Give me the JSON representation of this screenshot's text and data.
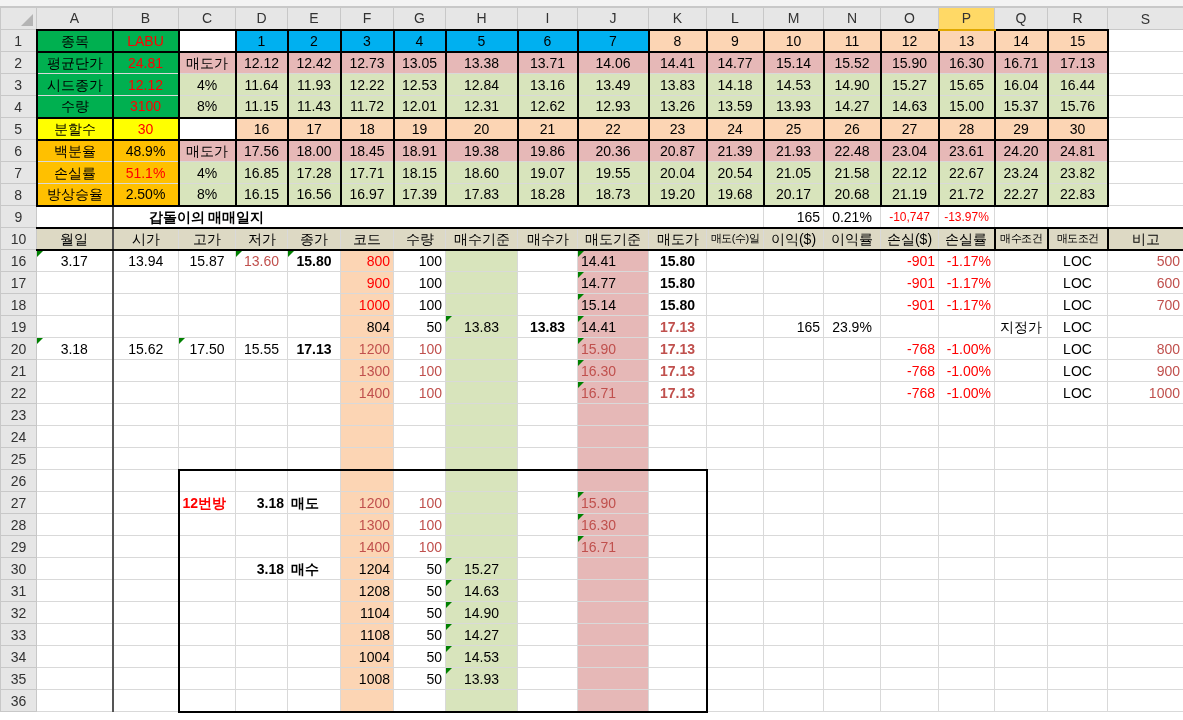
{
  "columns": [
    {
      "label": "A",
      "selected": false,
      "kind": "plain"
    },
    {
      "label": "B",
      "selected": false,
      "kind": "plain"
    },
    {
      "label": "C",
      "selected": false,
      "kind": "plain"
    },
    {
      "label": "D",
      "selected": false,
      "kind": "plain"
    },
    {
      "label": "E",
      "selected": false,
      "kind": "plain"
    },
    {
      "label": "F",
      "selected": false,
      "kind": "peach"
    },
    {
      "label": "G",
      "selected": false,
      "kind": "plain"
    },
    {
      "label": "H",
      "selected": false,
      "kind": "lightgreen"
    },
    {
      "label": "I",
      "selected": false,
      "kind": "plain"
    },
    {
      "label": "J",
      "selected": false,
      "kind": "pink"
    },
    {
      "label": "K",
      "selected": false,
      "kind": "plain"
    },
    {
      "label": "L",
      "selected": false,
      "kind": "plain"
    },
    {
      "label": "M",
      "selected": false,
      "kind": "plain"
    },
    {
      "label": "N",
      "selected": false,
      "kind": "plain"
    },
    {
      "label": "O",
      "selected": false,
      "kind": "plain"
    },
    {
      "label": "P",
      "selected": true,
      "kind": "plain"
    },
    {
      "label": "Q",
      "selected": false,
      "kind": "plain"
    },
    {
      "label": "R",
      "selected": false,
      "kind": "plain"
    },
    {
      "label": "S",
      "selected": false,
      "kind": "plain"
    }
  ],
  "rows": [
    {
      "number": "1",
      "cells": [
        {
          "text": "종목",
          "kind": "green"
        },
        {
          "text": "LABU",
          "kind": "green",
          "red": true
        },
        {
          "kind": "white"
        },
        {
          "text": "1",
          "kind": "blue"
        },
        {
          "text": "2",
          "kind": "blue"
        },
        {
          "text": "3",
          "kind": "blue"
        },
        {
          "text": "4",
          "kind": "blue"
        },
        {
          "text": "5",
          "kind": "blue"
        },
        {
          "text": "6",
          "kind": "blue"
        },
        {
          "text": "7",
          "kind": "blue"
        },
        {
          "text": "8",
          "kind": "peach"
        },
        {
          "text": "9",
          "kind": "peach"
        },
        {
          "text": "10",
          "kind": "peach"
        },
        {
          "text": "11",
          "kind": "peach"
        },
        {
          "text": "12",
          "kind": "peach"
        },
        {
          "text": "13",
          "kind": "peach"
        },
        {
          "text": "14",
          "kind": "peach"
        },
        {
          "text": "15",
          "kind": "peach"
        }
      ]
    },
    {
      "number": "2",
      "cells": [
        {
          "text": "평균단가",
          "kind": "green"
        },
        {
          "text": "24.81",
          "kind": "green",
          "red": true
        },
        {
          "text": "매도가",
          "kind": "pink"
        },
        {
          "text": "12.12",
          "kind": "pink"
        },
        {
          "text": "12.42",
          "kind": "pink"
        },
        {
          "text": "12.73",
          "kind": "pink"
        },
        {
          "text": "13.05",
          "kind": "pink"
        },
        {
          "text": "13.38",
          "kind": "pink"
        },
        {
          "text": "13.71",
          "kind": "pink"
        },
        {
          "text": "14.06",
          "kind": "pink"
        },
        {
          "text": "14.41",
          "kind": "pink"
        },
        {
          "text": "14.77",
          "kind": "pink"
        },
        {
          "text": "15.14",
          "kind": "pink"
        },
        {
          "text": "15.52",
          "kind": "pink"
        },
        {
          "text": "15.90",
          "kind": "pink"
        },
        {
          "text": "16.30",
          "kind": "pink"
        },
        {
          "text": "16.71",
          "kind": "pink"
        },
        {
          "text": "17.13",
          "kind": "pink"
        }
      ]
    },
    {
      "number": "3",
      "cells": [
        {
          "text": "시드종가",
          "kind": "green"
        },
        {
          "text": "12.12",
          "kind": "green",
          "red": true
        },
        {
          "text": "4%",
          "kind": "lightgreen"
        },
        {
          "text": "11.64",
          "kind": "lightgreen"
        },
        {
          "text": "11.93",
          "kind": "lightgreen"
        },
        {
          "text": "12.22",
          "kind": "lightgreen"
        },
        {
          "text": "12.53",
          "kind": "lightgreen"
        },
        {
          "text": "12.84",
          "kind": "lightgreen"
        },
        {
          "text": "13.16",
          "kind": "lightgreen"
        },
        {
          "text": "13.49",
          "kind": "lightgreen"
        },
        {
          "text": "13.83",
          "kind": "lightgreen"
        },
        {
          "text": "14.18",
          "kind": "lightgreen"
        },
        {
          "text": "14.53",
          "kind": "lightgreen"
        },
        {
          "text": "14.90",
          "kind": "lightgreen"
        },
        {
          "text": "15.27",
          "kind": "lightgreen"
        },
        {
          "text": "15.65",
          "kind": "lightgreen"
        },
        {
          "text": "16.04",
          "kind": "lightgreen"
        },
        {
          "text": "16.44",
          "kind": "lightgreen"
        }
      ]
    },
    {
      "number": "4",
      "cells": [
        {
          "text": "수량",
          "kind": "green"
        },
        {
          "text": "3100",
          "kind": "green",
          "red": true
        },
        {
          "text": "8%",
          "kind": "lightgreen"
        },
        {
          "text": "11.15",
          "kind": "lightgreen"
        },
        {
          "text": "11.43",
          "kind": "lightgreen"
        },
        {
          "text": "11.72",
          "kind": "lightgreen"
        },
        {
          "text": "12.01",
          "kind": "lightgreen"
        },
        {
          "text": "12.31",
          "kind": "lightgreen"
        },
        {
          "text": "12.62",
          "kind": "lightgreen"
        },
        {
          "text": "12.93",
          "kind": "lightgreen"
        },
        {
          "text": "13.26",
          "kind": "lightgreen"
        },
        {
          "text": "13.59",
          "kind": "lightgreen"
        },
        {
          "text": "13.93",
          "kind": "lightgreen"
        },
        {
          "text": "14.27",
          "kind": "lightgreen"
        },
        {
          "text": "14.63",
          "kind": "lightgreen"
        },
        {
          "text": "15.00",
          "kind": "lightgreen"
        },
        {
          "text": "15.37",
          "kind": "lightgreen"
        },
        {
          "text": "15.76",
          "kind": "lightgreen"
        }
      ]
    },
    {
      "number": "5",
      "cells": [
        {
          "text": "분할수",
          "kind": "yellow"
        },
        {
          "text": "30",
          "kind": "yellow",
          "red": true
        },
        {
          "kind": "white"
        },
        {
          "text": "16",
          "kind": "peach"
        },
        {
          "text": "17",
          "kind": "peach"
        },
        {
          "text": "18",
          "kind": "peach"
        },
        {
          "text": "19",
          "kind": "peach"
        },
        {
          "text": "20",
          "kind": "peach"
        },
        {
          "text": "21",
          "kind": "peach"
        },
        {
          "text": "22",
          "kind": "peach"
        },
        {
          "text": "23",
          "kind": "peach"
        },
        {
          "text": "24",
          "kind": "peach"
        },
        {
          "text": "25",
          "kind": "peach"
        },
        {
          "text": "26",
          "kind": "peach"
        },
        {
          "text": "27",
          "kind": "peach"
        },
        {
          "text": "28",
          "kind": "peach"
        },
        {
          "text": "29",
          "kind": "peach"
        },
        {
          "text": "30",
          "kind": "peach"
        }
      ]
    },
    {
      "number": "6",
      "cells": [
        {
          "text": "백분율",
          "kind": "orange"
        },
        {
          "text": "48.9%",
          "kind": "orange"
        },
        {
          "text": "매도가",
          "kind": "pink"
        },
        {
          "text": "17.56",
          "kind": "pink"
        },
        {
          "text": "18.00",
          "kind": "pink"
        },
        {
          "text": "18.45",
          "kind": "pink"
        },
        {
          "text": "18.91",
          "kind": "pink"
        },
        {
          "text": "19.38",
          "kind": "pink"
        },
        {
          "text": "19.86",
          "kind": "pink"
        },
        {
          "text": "20.36",
          "kind": "pink"
        },
        {
          "text": "20.87",
          "kind": "pink"
        },
        {
          "text": "21.39",
          "kind": "pink"
        },
        {
          "text": "21.93",
          "kind": "pink"
        },
        {
          "text": "22.48",
          "kind": "pink"
        },
        {
          "text": "23.04",
          "kind": "pink"
        },
        {
          "text": "23.61",
          "kind": "pink"
        },
        {
          "text": "24.20",
          "kind": "pink"
        },
        {
          "text": "24.81",
          "kind": "pink"
        }
      ]
    },
    {
      "number": "7",
      "cells": [
        {
          "text": "손실률",
          "kind": "orange"
        },
        {
          "text": "51.1%",
          "kind": "orange",
          "red": true
        },
        {
          "text": "4%",
          "kind": "lightgreen"
        },
        {
          "text": "16.85",
          "kind": "lightgreen"
        },
        {
          "text": "17.28",
          "kind": "lightgreen"
        },
        {
          "text": "17.71",
          "kind": "lightgreen"
        },
        {
          "text": "18.15",
          "kind": "lightgreen"
        },
        {
          "text": "18.60",
          "kind": "lightgreen"
        },
        {
          "text": "19.07",
          "kind": "lightgreen"
        },
        {
          "text": "19.55",
          "kind": "lightgreen"
        },
        {
          "text": "20.04",
          "kind": "lightgreen"
        },
        {
          "text": "20.54",
          "kind": "lightgreen"
        },
        {
          "text": "21.05",
          "kind": "lightgreen"
        },
        {
          "text": "21.58",
          "kind": "lightgreen"
        },
        {
          "text": "22.12",
          "kind": "lightgreen"
        },
        {
          "text": "22.67",
          "kind": "lightgreen"
        },
        {
          "text": "23.24",
          "kind": "lightgreen"
        },
        {
          "text": "23.82",
          "kind": "lightgreen"
        }
      ]
    },
    {
      "number": "8",
      "cells": [
        {
          "text": "방상승율",
          "kind": "orange"
        },
        {
          "text": "2.50%",
          "kind": "orange"
        },
        {
          "text": "8%",
          "kind": "lightgreen"
        },
        {
          "text": "16.15",
          "kind": "lightgreen"
        },
        {
          "text": "16.56",
          "kind": "lightgreen"
        },
        {
          "text": "16.97",
          "kind": "lightgreen"
        },
        {
          "text": "17.39",
          "kind": "lightgreen"
        },
        {
          "text": "17.83",
          "kind": "lightgreen"
        },
        {
          "text": "18.28",
          "kind": "lightgreen"
        },
        {
          "text": "18.73",
          "kind": "lightgreen"
        },
        {
          "text": "19.20",
          "kind": "lightgreen"
        },
        {
          "text": "19.68",
          "kind": "lightgreen"
        },
        {
          "text": "20.17",
          "kind": "lightgreen"
        },
        {
          "text": "20.68",
          "kind": "lightgreen"
        },
        {
          "text": "21.19",
          "kind": "lightgreen"
        },
        {
          "text": "21.72",
          "kind": "lightgreen"
        },
        {
          "text": "22.27",
          "kind": "lightgreen"
        },
        {
          "text": "22.83",
          "kind": "lightgreen"
        }
      ]
    },
    {
      "number": "9",
      "cells": [
        {},
        {
          "text": "갑돌이의 매매일지",
          "kind": "title"
        },
        {
          "text": "165"
        },
        {
          "text": "0.21%"
        },
        {
          "text": "-10,747",
          "kind": "note",
          "red": true
        },
        {
          "text": "-13.97%",
          "kind": "note",
          "red": true
        }
      ]
    },
    {
      "number": "10",
      "cells": [
        {
          "text": "월일",
          "kind": "header"
        },
        {
          "text": "시가",
          "kind": "header"
        },
        {
          "text": "고가",
          "kind": "header"
        },
        {
          "text": "저가",
          "kind": "header"
        },
        {
          "text": "종가",
          "kind": "header"
        },
        {
          "text": "코드",
          "kind": "header"
        },
        {
          "text": "수량",
          "kind": "header"
        },
        {
          "text": "매수기준",
          "kind": "header"
        },
        {
          "text": "매수가",
          "kind": "header"
        },
        {
          "text": "매도기준",
          "kind": "header"
        },
        {
          "text": "매도가",
          "kind": "header"
        },
        {
          "text": "매도(수)일",
          "kind": "smallheader"
        },
        {
          "text": "이익($)",
          "kind": "header"
        },
        {
          "text": "이익률",
          "kind": "header"
        },
        {
          "text": "손실($)",
          "kind": "header"
        },
        {
          "text": "손실률",
          "kind": "header"
        },
        {
          "text": "매수조건",
          "kind": "smallheader"
        },
        {
          "text": "매도조건",
          "kind": "smallheader"
        },
        {
          "text": "비고",
          "kind": "header"
        }
      ]
    },
    {
      "number": "16",
      "cells": [
        {
          "text": "3.17",
          "flag": true
        },
        {
          "text": "13.94"
        },
        {
          "text": "15.87"
        },
        {
          "text": "13.60",
          "muted": true,
          "flag": true
        },
        {
          "text": "15.80",
          "bold": true,
          "flag": true
        },
        {
          "text": "800",
          "red": true
        },
        {
          "text": "100"
        },
        {},
        {},
        {
          "text": "14.41",
          "flag": true
        },
        {
          "text": "15.80",
          "bold": true
        },
        {},
        {},
        {},
        {
          "text": "-901",
          "red": true
        },
        {
          "text": "-1.17%",
          "red": true
        },
        {},
        {
          "text": "LOC"
        },
        {
          "text": "500",
          "muted": true
        }
      ]
    },
    {
      "number": "17",
      "cells": [
        {},
        {},
        {},
        {},
        {},
        {
          "text": "900",
          "red": true
        },
        {
          "text": "100"
        },
        {},
        {},
        {
          "text": "14.77",
          "flag": true
        },
        {
          "text": "15.80",
          "bold": true
        },
        {},
        {},
        {},
        {
          "text": "-901",
          "red": true
        },
        {
          "text": "-1.17%",
          "red": true
        },
        {},
        {
          "text": "LOC"
        },
        {
          "text": "600",
          "muted": true
        }
      ]
    },
    {
      "number": "18",
      "cells": [
        {},
        {},
        {},
        {},
        {},
        {
          "text": "1000",
          "red": true
        },
        {
          "text": "100"
        },
        {},
        {},
        {
          "text": "15.14",
          "flag": true
        },
        {
          "text": "15.80",
          "bold": true
        },
        {},
        {},
        {},
        {
          "text": "-901",
          "red": true
        },
        {
          "text": "-1.17%",
          "red": true
        },
        {},
        {
          "text": "LOC"
        },
        {
          "text": "700",
          "muted": true
        }
      ]
    },
    {
      "number": "19",
      "cells": [
        {},
        {},
        {},
        {},
        {},
        {
          "text": "804"
        },
        {
          "text": "50"
        },
        {
          "text": "13.83",
          "flag": true
        },
        {
          "text": "13.83",
          "bold": true
        },
        {
          "text": "14.41",
          "flag": true
        },
        {
          "text": "17.13",
          "bold": true,
          "muted": true
        },
        {},
        {
          "text": "165"
        },
        {
          "text": "23.9%"
        },
        {},
        {},
        {
          "text": "지정가"
        },
        {
          "text": "LOC"
        }
      ]
    },
    {
      "number": "20",
      "cells": [
        {
          "text": "3.18",
          "flag": true
        },
        {
          "text": "15.62"
        },
        {
          "text": "17.50",
          "flag": true
        },
        {
          "text": "15.55"
        },
        {
          "text": "17.13",
          "bold": true
        },
        {
          "text": "1200",
          "muted": true
        },
        {
          "text": "100",
          "muted": true
        },
        {},
        {},
        {
          "text": "15.90",
          "muted": true,
          "flag": true
        },
        {
          "text": "17.13",
          "bold": true,
          "muted": true
        },
        {},
        {},
        {},
        {
          "text": "-768",
          "red": true
        },
        {
          "text": "-1.00%",
          "red": true
        },
        {},
        {
          "text": "LOC"
        },
        {
          "text": "800",
          "muted": true
        }
      ]
    },
    {
      "number": "21",
      "cells": [
        {},
        {},
        {},
        {},
        {},
        {
          "text": "1300",
          "muted": true
        },
        {
          "text": "100",
          "muted": true
        },
        {},
        {},
        {
          "text": "16.30",
          "muted": true,
          "flag": true
        },
        {
          "text": "17.13",
          "bold": true,
          "muted": true
        },
        {},
        {},
        {},
        {
          "text": "-768",
          "red": true
        },
        {
          "text": "-1.00%",
          "red": true
        },
        {},
        {
          "text": "LOC"
        },
        {
          "text": "900",
          "muted": true
        }
      ]
    },
    {
      "number": "22",
      "cells": [
        {},
        {},
        {},
        {},
        {},
        {
          "text": "1400",
          "muted": true
        },
        {
          "text": "100",
          "muted": true
        },
        {},
        {},
        {
          "text": "16.71",
          "muted": true,
          "flag": true
        },
        {
          "text": "17.13",
          "bold": true,
          "muted": true
        },
        {},
        {},
        {},
        {
          "text": "-768",
          "red": true
        },
        {
          "text": "-1.00%",
          "red": true
        },
        {},
        {
          "text": "LOC"
        },
        {
          "text": "1000",
          "muted": true
        }
      ]
    },
    {
      "number": "23",
      "cells": []
    },
    {
      "number": "24",
      "cells": []
    },
    {
      "number": "25",
      "cells": []
    },
    {
      "number": "26",
      "cells": []
    },
    {
      "number": "27",
      "cells": [
        {},
        {},
        {
          "text": "12번방",
          "bold": true,
          "red": true
        },
        {
          "text": "3.18",
          "bold": true
        },
        {
          "text": "매도",
          "bold": true
        },
        {
          "text": "1200",
          "muted": true
        },
        {
          "text": "100",
          "muted": true
        },
        {},
        {},
        {
          "text": "15.90",
          "muted": true,
          "flag": true
        }
      ]
    },
    {
      "number": "28",
      "cells": [
        {},
        {},
        {},
        {},
        {},
        {
          "text": "1300",
          "muted": true
        },
        {
          "text": "100",
          "muted": true
        },
        {},
        {},
        {
          "text": "16.30",
          "muted": true,
          "flag": true
        }
      ]
    },
    {
      "number": "29",
      "cells": [
        {},
        {},
        {},
        {},
        {},
        {
          "text": "1400",
          "muted": true
        },
        {
          "text": "100",
          "muted": true
        },
        {},
        {},
        {
          "text": "16.71",
          "muted": true,
          "flag": true
        }
      ]
    },
    {
      "number": "30",
      "cells": [
        {},
        {},
        {},
        {
          "text": "3.18",
          "bold": true
        },
        {
          "text": "매수",
          "bold": true
        },
        {
          "text": "1204"
        },
        {
          "text": "50"
        },
        {
          "text": "15.27",
          "flag": true
        }
      ]
    },
    {
      "number": "31",
      "cells": [
        {},
        {},
        {},
        {},
        {},
        {
          "text": "1208"
        },
        {
          "text": "50"
        },
        {
          "text": "14.63",
          "flag": true
        }
      ]
    },
    {
      "number": "32",
      "cells": [
        {},
        {},
        {},
        {},
        {},
        {
          "text": "1104"
        },
        {
          "text": "50"
        },
        {
          "text": "14.90",
          "flag": true
        }
      ]
    },
    {
      "number": "33",
      "cells": [
        {},
        {},
        {},
        {},
        {},
        {
          "text": "1108"
        },
        {
          "text": "50"
        },
        {
          "text": "14.27",
          "flag": true
        }
      ]
    },
    {
      "number": "34",
      "cells": [
        {},
        {},
        {},
        {},
        {},
        {
          "text": "1004"
        },
        {
          "text": "50"
        },
        {
          "text": "14.53",
          "flag": true
        }
      ]
    },
    {
      "number": "35",
      "cells": [
        {},
        {},
        {},
        {},
        {},
        {
          "text": "1008"
        },
        {
          "text": "50"
        },
        {
          "text": "13.93",
          "flag": true
        }
      ]
    },
    {
      "number": "36",
      "cells": []
    }
  ]
}
